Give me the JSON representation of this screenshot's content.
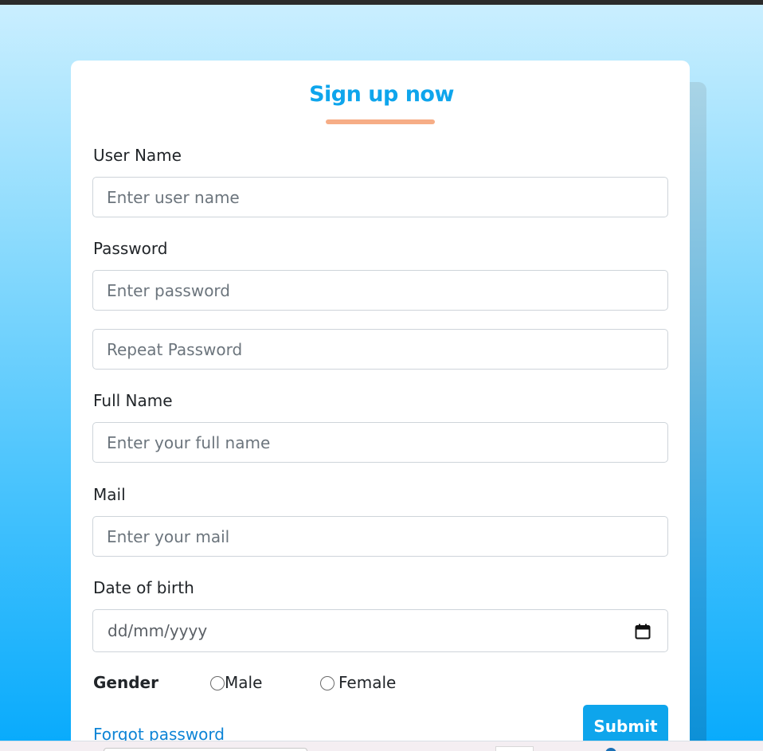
{
  "colors": {
    "accent": "#0ea5ec",
    "title_underline": "#f6ad86",
    "link": "#0d84d6",
    "background_top": "#cbefff",
    "background_bottom": "#07aafc"
  },
  "form": {
    "title": "Sign up now",
    "username": {
      "label": "User Name",
      "placeholder": "Enter user name",
      "value": ""
    },
    "password": {
      "label": "Password",
      "placeholder": "Enter password",
      "value": ""
    },
    "repeat_password": {
      "placeholder": "Repeat Password",
      "value": ""
    },
    "full_name": {
      "label": "Full Name",
      "placeholder": "Enter your full name",
      "value": ""
    },
    "mail": {
      "label": "Mail",
      "placeholder": "Enter your mail",
      "value": ""
    },
    "dob": {
      "label": "Date of birth",
      "placeholder": "dd/mm/yyyy",
      "icon": "calendar-icon"
    },
    "gender": {
      "label": "Gender",
      "options": [
        {
          "label": "Male",
          "checked": false
        },
        {
          "label": "Female",
          "checked": false
        }
      ]
    },
    "forgot_password": "Forgot password",
    "submit_label": "Submit"
  }
}
